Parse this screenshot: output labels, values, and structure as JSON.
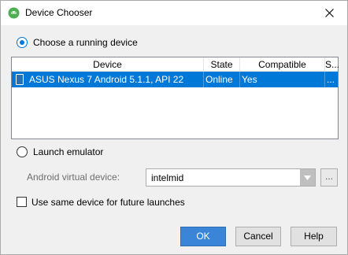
{
  "window": {
    "title": "Device Chooser"
  },
  "running": {
    "label": "Choose a running device",
    "selected": true
  },
  "table": {
    "headers": [
      "Device",
      "State",
      "Compatible",
      "S..."
    ],
    "rows": [
      {
        "device": "ASUS Nexus 7 Android 5.1.1, API 22",
        "state": "Online",
        "compatible": "Yes",
        "s": "..."
      }
    ]
  },
  "emulator": {
    "label": "Launch emulator",
    "selected": false,
    "avd_label": "Android virtual device:",
    "avd_value": "intelmid",
    "browse_label": "..."
  },
  "same_device": {
    "label": "Use same device for future launches",
    "checked": false
  },
  "buttons": {
    "ok": "OK",
    "cancel": "Cancel",
    "help": "Help"
  },
  "colors": {
    "selection": "#0078d7",
    "primary_button": "#3b85d9"
  }
}
